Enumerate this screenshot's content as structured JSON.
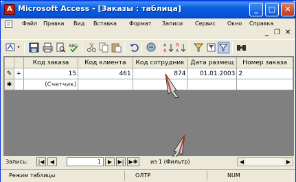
{
  "window": {
    "title": "Microsoft Access - [Заказы : таблица]",
    "app_icon": "access-key-icon",
    "min_label": "_",
    "max_label": "□",
    "close_label": "✕"
  },
  "menu": {
    "items": [
      {
        "label": "Файл"
      },
      {
        "label": "Правка"
      },
      {
        "label": "Вид"
      },
      {
        "label": "Вставка"
      },
      {
        "label": "Формат"
      },
      {
        "label": "Записи"
      },
      {
        "label": "Сервис"
      },
      {
        "label": "Окно"
      },
      {
        "label": "Справка"
      }
    ],
    "mdi_min": "_",
    "mdi_restore": "❐",
    "mdi_close": "✕"
  },
  "toolbar": {
    "icons": [
      "view-icon",
      "save-icon",
      "print-icon",
      "print-preview-icon",
      "spelling-icon",
      "cut-icon",
      "copy-icon",
      "paste-icon",
      "undo-icon",
      "hyperlink-icon",
      "sort-ascending-icon",
      "sort-descending-icon",
      "filter-by-selection-icon",
      "filter-by-form-icon",
      "apply-filter-icon",
      "find-icon"
    ]
  },
  "table": {
    "columns": [
      "Код заказа",
      "Код клиента",
      "Код сотрудник",
      "Дата размещ",
      "Номер заказа"
    ],
    "rows": [
      {
        "selector": "✎",
        "expand": "+",
        "cells": [
          "15",
          "461",
          "874",
          "01.01.2003",
          "2"
        ]
      }
    ],
    "new_row": {
      "selector": "✱",
      "cells": [
        "(Счетчик)",
        "",
        "",
        "",
        ""
      ]
    }
  },
  "navigation": {
    "label": "Запись:",
    "current": "1",
    "count_text": "из 1 (Фильтр)",
    "first": "|◀",
    "prev": "◀",
    "next": "▶",
    "last": "▶|",
    "new": "▶✱"
  },
  "status": {
    "mode": "Режим таблицы",
    "ovr": "ОЛТР",
    "num": "NUM"
  }
}
